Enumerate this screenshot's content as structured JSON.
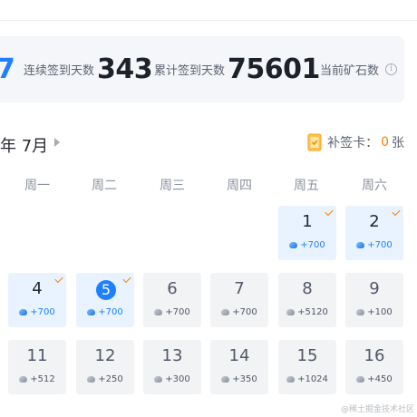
{
  "stats": {
    "current_value": "7",
    "continuous_label": "连续签到天数",
    "continuous_days": "343",
    "total_label": "累计签到天数",
    "total_days": "75601",
    "ore_label": "当前矿石数",
    "info_icon": "i"
  },
  "calendar": {
    "month_title": "年 7月",
    "makeup_label": "补签卡：",
    "makeup_count": "0",
    "makeup_unit": "张",
    "weekdays": [
      "周一",
      "周二",
      "周三",
      "周四",
      "周五",
      "周六"
    ],
    "days": [
      {
        "day": "1",
        "reward": "+700",
        "signed": true
      },
      {
        "day": "2",
        "reward": "+700",
        "signed": true
      },
      {
        "day": "4",
        "reward": "+700",
        "signed": true
      },
      {
        "day": "5",
        "reward": "+700",
        "signed": true,
        "today": true
      },
      {
        "day": "6",
        "reward": "+700",
        "signed": false
      },
      {
        "day": "7",
        "reward": "+700",
        "signed": false
      },
      {
        "day": "8",
        "reward": "+5120",
        "signed": false
      },
      {
        "day": "9",
        "reward": "+100",
        "signed": false
      },
      {
        "day": "11",
        "reward": "+512",
        "signed": false
      },
      {
        "day": "12",
        "reward": "+250",
        "signed": false
      },
      {
        "day": "13",
        "reward": "+300",
        "signed": false
      },
      {
        "day": "14",
        "reward": "+350",
        "signed": false
      },
      {
        "day": "15",
        "reward": "+1024",
        "signed": false
      },
      {
        "day": "16",
        "reward": "+450",
        "signed": false
      }
    ]
  },
  "watermark": "@稀土掘金技术社区",
  "colors": {
    "accent": "#1e80ff",
    "signed_bg": "#e8f3ff",
    "unsigned_bg": "#f2f3f5",
    "check": "#ff7d00"
  }
}
